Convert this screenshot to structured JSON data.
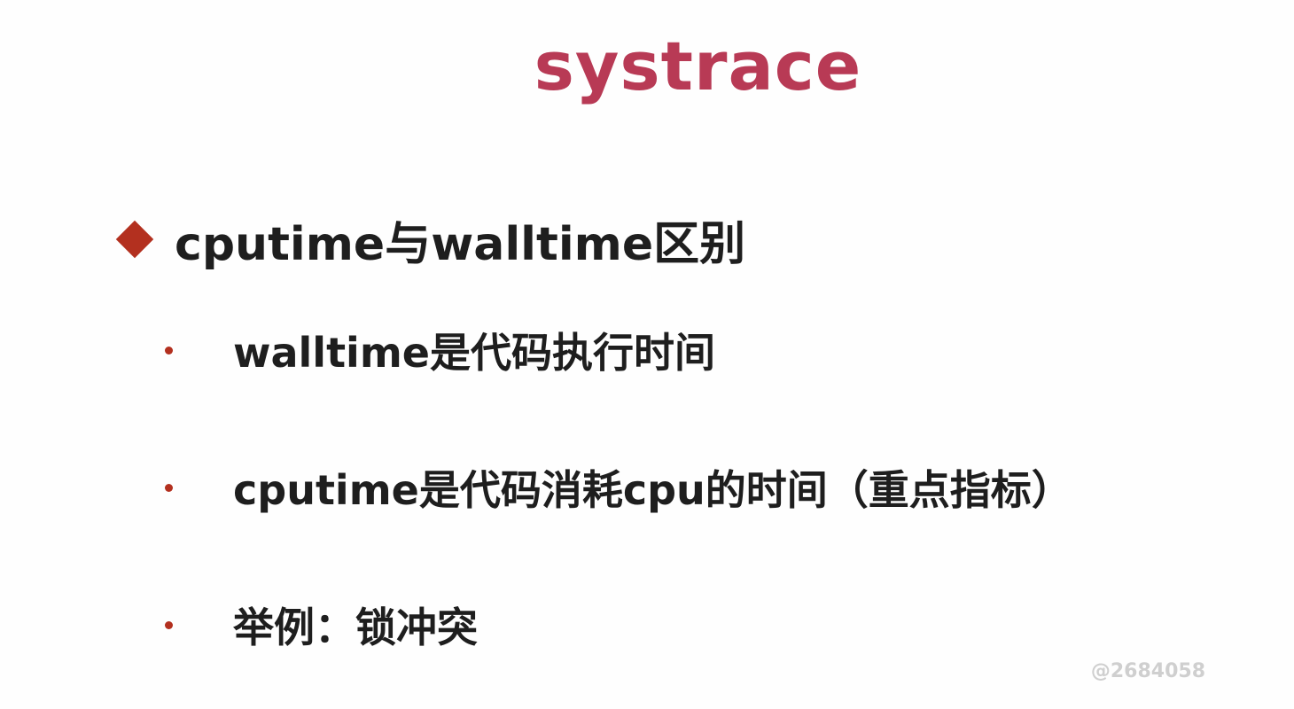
{
  "slide": {
    "title": "systrace",
    "main_point": "cputime与walltime区别",
    "bullets": [
      "walltime是代码执行时间",
      "cputime是代码消耗cpu的时间（重点指标）",
      "举例：锁冲突"
    ],
    "watermark": "@2684058"
  },
  "colors": {
    "title": "#b83a55",
    "diamond": "#b3301f",
    "bullet_dot": "#b3301f",
    "text": "#1e1e1e"
  },
  "icons": {
    "main_marker": "diamond-bullet-icon",
    "sub_marker": "dot-bullet-icon"
  }
}
